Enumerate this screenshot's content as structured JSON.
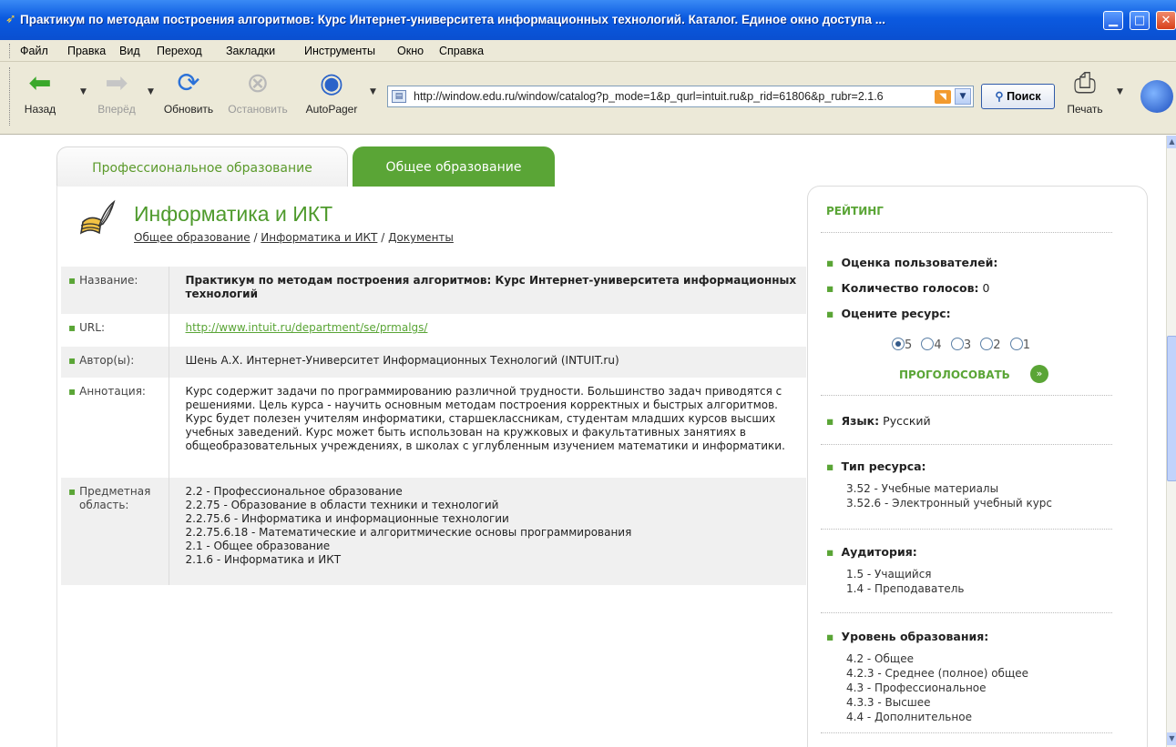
{
  "window": {
    "title": "Практикум по методам построения алгоритмов: Курс Интернет-университета информационных технологий. Каталог. Единое окно доступа ...",
    "minimize": "▁",
    "maximize": "□",
    "close": "✕"
  },
  "menu": [
    "Файл",
    "Правка",
    "Вид",
    "Переход",
    "Закладки",
    "Инструменты",
    "Окно",
    "Справка"
  ],
  "toolbar": {
    "back": "Назад",
    "forward": "Вперёд",
    "reload": "Обновить",
    "stop": "Остановить",
    "autopager": "AutoPager",
    "print": "Печать",
    "search": "Поиск",
    "url": "http://window.edu.ru/window/catalog?p_mode=1&p_qurl=intuit.ru&p_rid=61806&p_rubr=2.1.6"
  },
  "tabs": {
    "professional": "Профессиональное образование",
    "general": "Общее образование"
  },
  "section": {
    "title": "Информатика и ИКТ",
    "breadcrumb": [
      "Общее образование",
      "Информатика и ИКТ",
      "Документы"
    ],
    "breadcrumb_sep": " / "
  },
  "info": {
    "name_label": "Название:",
    "name_value": "Практикум по методам построения алгоритмов: Курс Интернет-университета информационных технологий",
    "url_label": "URL:",
    "url_value": "http://www.intuit.ru/department/se/prmalgs/",
    "author_label": "Автор(ы):",
    "author_value": "Шень А.Х. Интернет-Университет Информационных Технологий (INTUIT.ru)",
    "annotation_label": "Аннотация:",
    "annotation_value": "Курс содержит задачи по программированию различной трудности. Большинство задач приводятся с решениями. Цель курса - научить основным методам построения корректных и быстрых алгоритмов. Курс будет полезен учителям информатики, старшеклассникам, студентам младших курсов высших учебных заведений. Курс может быть использован на кружковых и факультативных занятиях в общеобразовательных учреждениях, в школах с углубленным изучением математики и информатики.",
    "subject_label_1": "Предметная",
    "subject_label_2": "область:",
    "subjects": [
      "2.2 - Профессиональное образование",
      "2.2.75 - Образование в области техники и технологий",
      "2.2.75.6 - Информатика и информационные технологии",
      "2.2.75.6.18 - Математические и алгоритмические основы программирования",
      "2.1 - Общее образование",
      "2.1.6 - Информатика и ИКТ"
    ]
  },
  "sidebar": {
    "rating_head": "РЕЙТИНГ",
    "user_rating": "Оценка пользователей:",
    "votes_label": "Количество голосов:",
    "votes_value": "0",
    "rate_label": "Оцените ресурс:",
    "radios": [
      "5",
      "4",
      "3",
      "2",
      "1"
    ],
    "selected": "5",
    "vote": "ПРОГОЛОСОВАТЬ",
    "lang_label": "Язык:",
    "lang_value": "Русский",
    "type_label": "Тип ресурса:",
    "types": [
      "3.52 - Учебные материалы",
      "3.52.6 - Электронный учебный курс"
    ],
    "audience_label": "Аудитория:",
    "audience": [
      "1.5 - Учащийся",
      "1.4 - Преподаватель"
    ],
    "level_label": "Уровень образования:",
    "levels": [
      "4.2 - Общее",
      "4.2.3 - Среднее (полное) общее",
      "4.3 - Профессиональное",
      "4.3.3 - Высшее",
      "4.4 - Дополнительное"
    ]
  },
  "colors": {
    "accent": "#5aa536",
    "titlebar": "#0b5ae0",
    "chrome": "#ece9d8"
  }
}
